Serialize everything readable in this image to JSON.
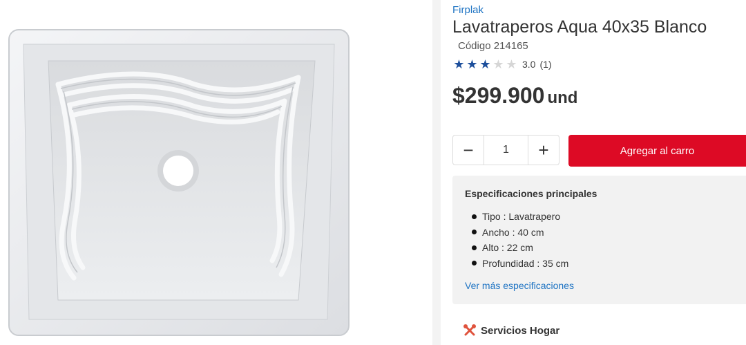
{
  "product": {
    "brand": "Firplak",
    "title": "Lavatraperos Aqua 40x35 Blanco",
    "code": "Código 214165",
    "rating": {
      "value": "3.0",
      "count": "(1)",
      "stars_filled": 3,
      "stars_total": 5
    },
    "price": {
      "amount": "$299.900",
      "unit": "und"
    },
    "image_icon": "white-laundry-sink-photo"
  },
  "quantity": {
    "value": "1",
    "decrement_label": "−",
    "increment_label": "+"
  },
  "cart": {
    "add_label": "Agregar al carro"
  },
  "specs": {
    "title": "Especificaciones principales",
    "items": [
      "Tipo : Lavatrapero",
      "Ancho : 40 cm",
      "Alto : 22 cm",
      "Profundidad : 35 cm"
    ],
    "more_link": "Ver más especificaciones"
  },
  "services": {
    "label": "Servicios Hogar",
    "icon": "tools-icon"
  },
  "colors": {
    "brand_link": "#1d73c3",
    "cart_button": "#dd0a25",
    "star": "#1d4f9c",
    "panel_bg": "#f2f2f2"
  }
}
